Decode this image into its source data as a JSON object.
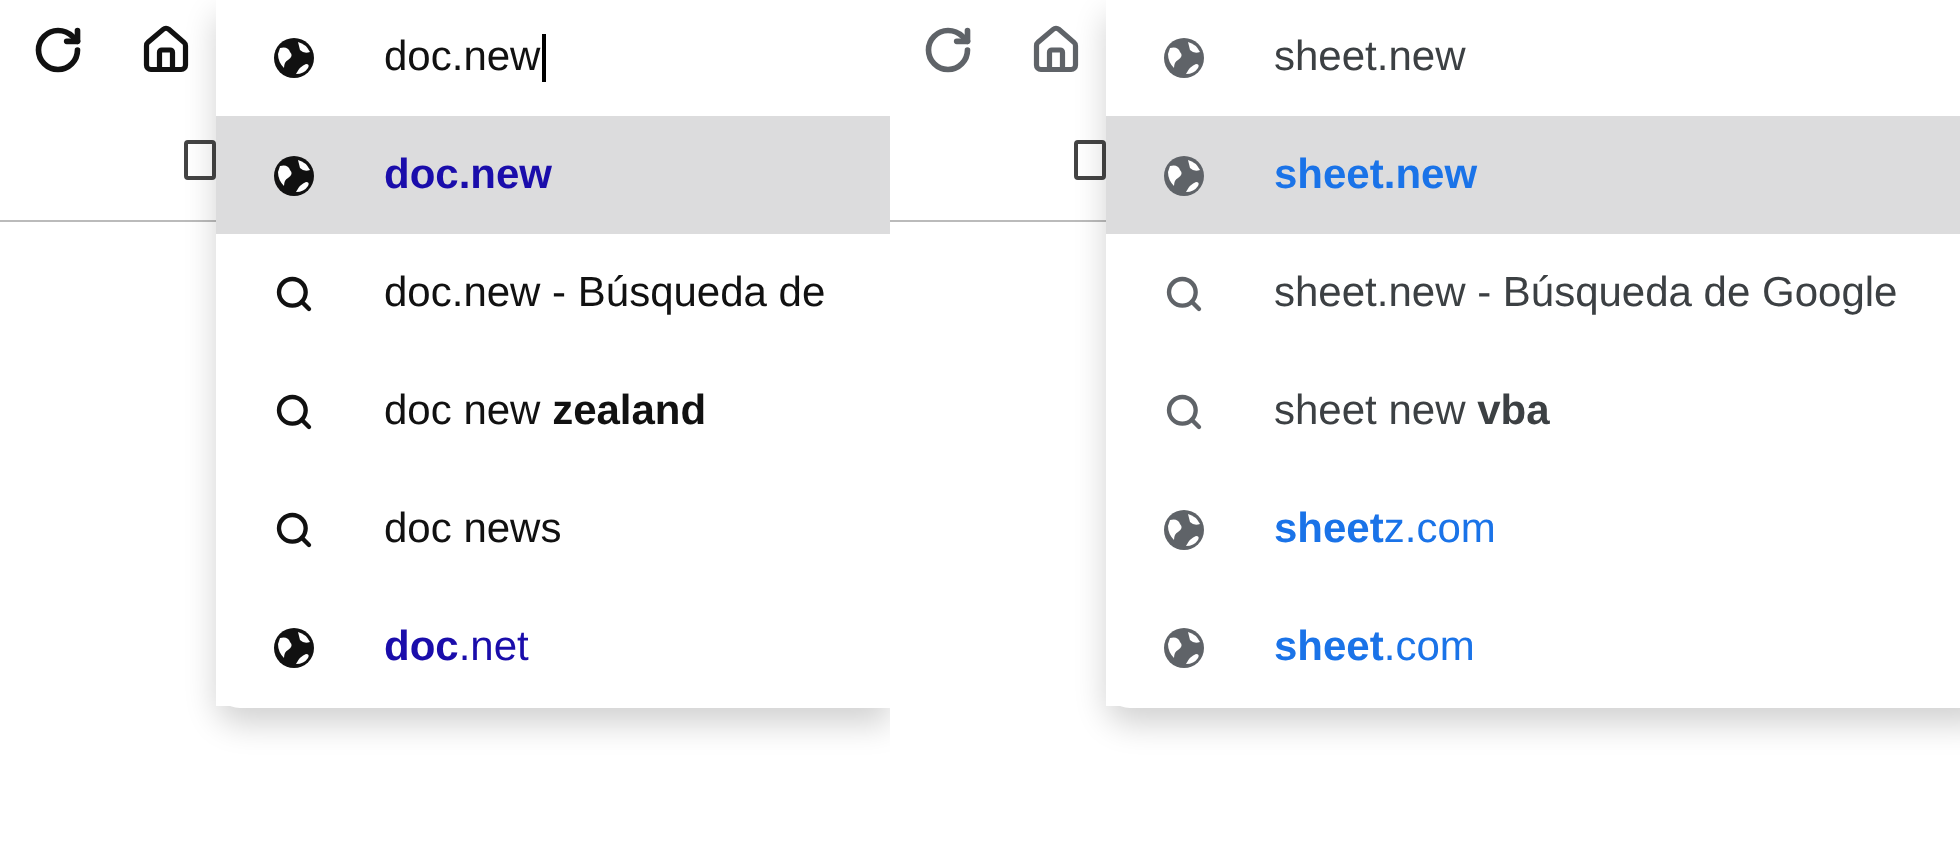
{
  "panels": [
    {
      "kind": "classic",
      "input": {
        "value": "doc.new"
      },
      "suggestions": [
        {
          "kind": "url",
          "text": "**doc.new**",
          "selected": true
        },
        {
          "kind": "search",
          "text": "doc.new - Búsqueda de",
          "selected": false
        },
        {
          "kind": "search",
          "text": "doc new **zealand**",
          "selected": false
        },
        {
          "kind": "search",
          "text": "doc news",
          "selected": false
        },
        {
          "kind": "url",
          "text": "**doc**.net",
          "selected": false
        }
      ]
    },
    {
      "kind": "material",
      "input": {
        "value": "sheet.new"
      },
      "suggestions": [
        {
          "kind": "url",
          "text": "**sheet.new**",
          "selected": true
        },
        {
          "kind": "search",
          "text": "sheet.new - Búsqueda de Google",
          "selected": false
        },
        {
          "kind": "search",
          "text": "sheet new **vba**",
          "selected": false
        },
        {
          "kind": "url",
          "text": "**sheet**z.com",
          "selected": false
        },
        {
          "kind": "url",
          "text": "**sheet**.com",
          "selected": false
        }
      ]
    }
  ]
}
